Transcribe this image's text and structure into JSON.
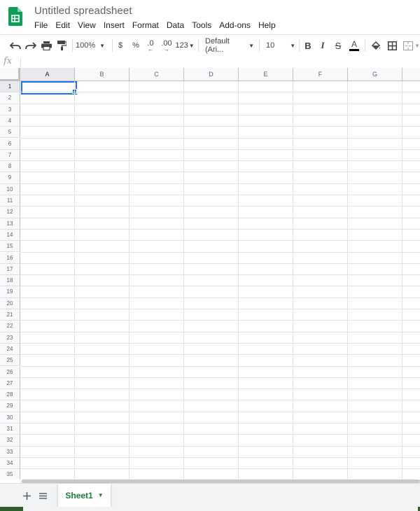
{
  "app": {
    "title": "Untitled spreadsheet",
    "brand_color": "#0f9d58",
    "icon": "sheets-logo-icon"
  },
  "menubar": {
    "items": [
      "File",
      "Edit",
      "View",
      "Insert",
      "Format",
      "Data",
      "Tools",
      "Add-ons",
      "Help"
    ]
  },
  "toolbar": {
    "undo_icon": "undo-icon",
    "redo_icon": "redo-icon",
    "print_icon": "print-icon",
    "paint_format_icon": "paint-format-icon",
    "zoom": "100%",
    "currency": "$",
    "percent": "%",
    "decrease_decimal": ".0",
    "increase_decimal": ".00",
    "more_formats": "123",
    "font": "Default (Ari...",
    "font_size": "10",
    "bold": "B",
    "italic": "I",
    "strikethrough": "S",
    "text_color": "A"
  },
  "formula_bar": {
    "fx_label": "fx",
    "value": ""
  },
  "grid": {
    "columns": [
      "A",
      "B",
      "C",
      "D",
      "E",
      "F",
      "G"
    ],
    "rows": [
      "1",
      "2",
      "3",
      "4",
      "5",
      "6",
      "7",
      "8",
      "9",
      "10",
      "11",
      "12",
      "13",
      "14",
      "15",
      "16",
      "17",
      "18",
      "19",
      "20",
      "21",
      "22",
      "23",
      "24",
      "25",
      "26",
      "27",
      "28",
      "29",
      "30",
      "31",
      "32",
      "33",
      "34",
      "35"
    ],
    "active_cell": "A1",
    "selection_color": "#1a73e8"
  },
  "sheets": {
    "add_icon": "add-sheet-icon",
    "list_icon": "all-sheets-icon",
    "tabs": [
      "Sheet1"
    ],
    "active_color": "#188038"
  }
}
